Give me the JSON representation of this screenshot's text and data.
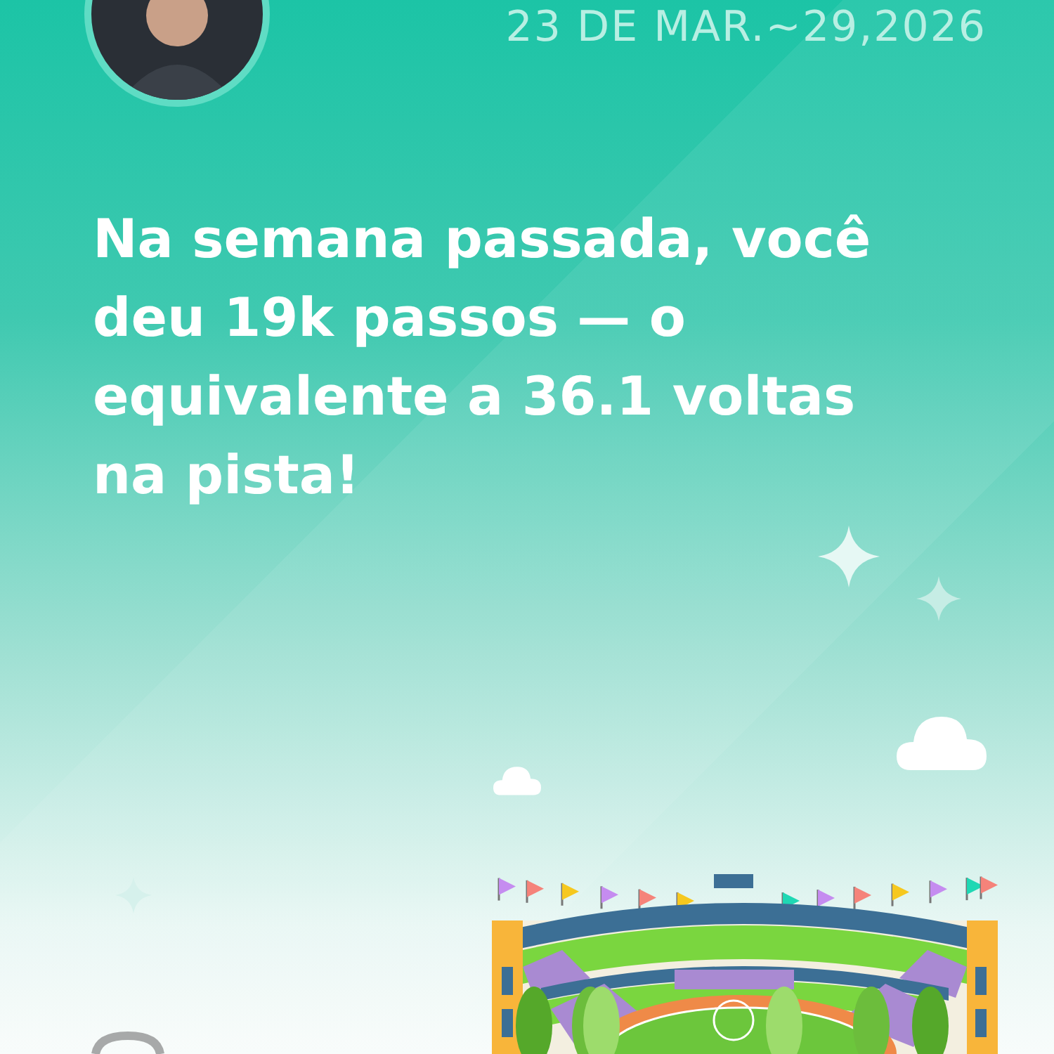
{
  "header": {
    "date_range": "23 DE MAR.~29,2026"
  },
  "message": "Na semana passada, você deu 19k passos — o equivalente a 36.1 voltas na pista!"
}
